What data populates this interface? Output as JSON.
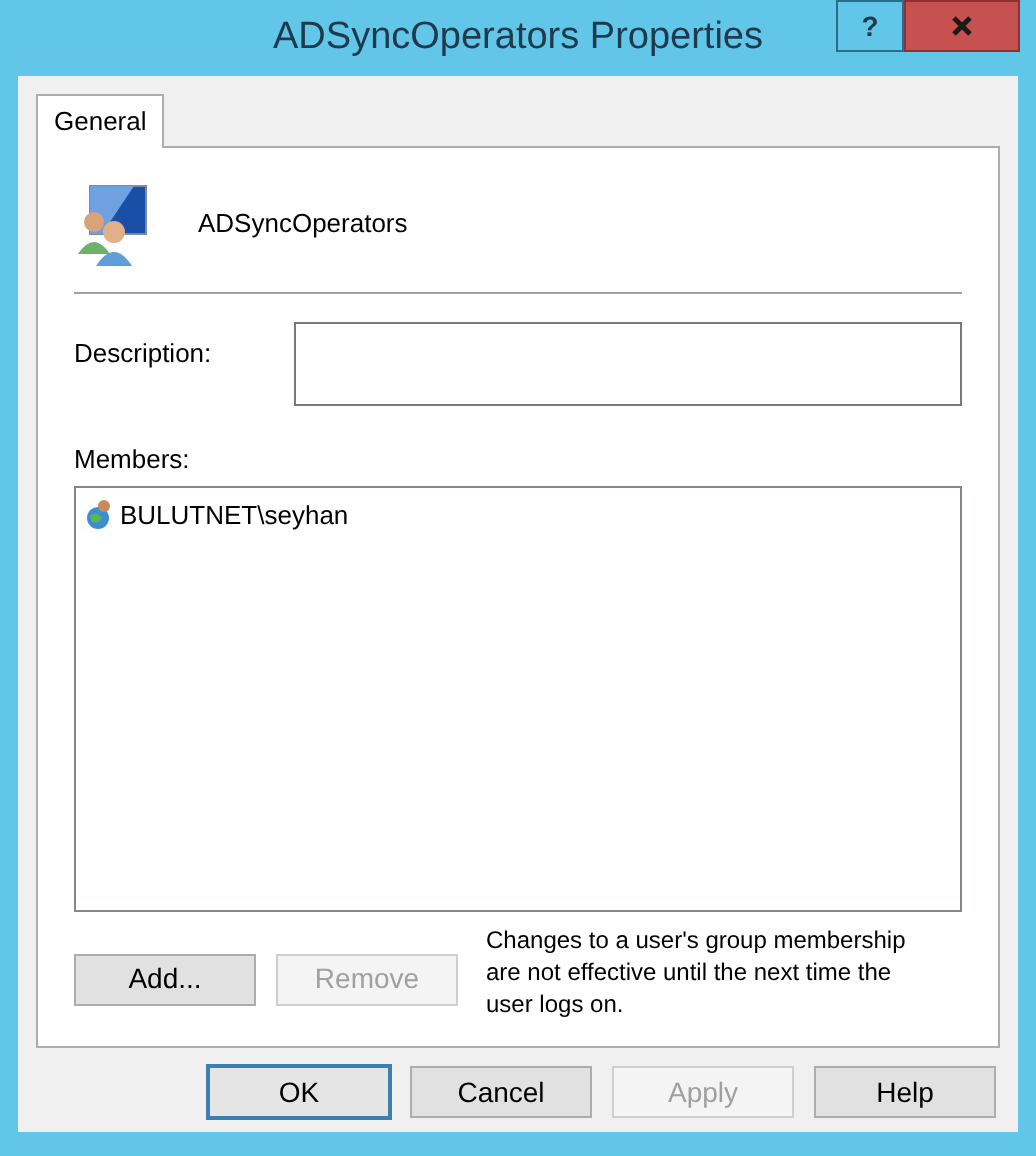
{
  "window": {
    "title": "ADSyncOperators Properties",
    "help_button": "?"
  },
  "tabs": [
    {
      "label": "General",
      "selected": true
    }
  ],
  "group": {
    "name": "ADSyncOperators"
  },
  "description": {
    "label": "Description:"
  },
  "members": {
    "label": "Members:",
    "items": [
      {
        "name": "BULUTNET\\seyhan",
        "selected": false
      }
    ]
  },
  "member_buttons": [
    {
      "label": "Add...",
      "disabled": false
    },
    {
      "label": "Remove",
      "disabled": true
    }
  ],
  "note": "Changes to a user's group membership are not effective until the next time the user logs on.",
  "buttons": [
    {
      "label": "OK",
      "disabled": false,
      "default": true
    },
    {
      "label": "Cancel",
      "disabled": false,
      "default": false
    },
    {
      "label": "Apply",
      "disabled": true,
      "default": false
    },
    {
      "label": "Help",
      "disabled": false,
      "default": false
    }
  ]
}
